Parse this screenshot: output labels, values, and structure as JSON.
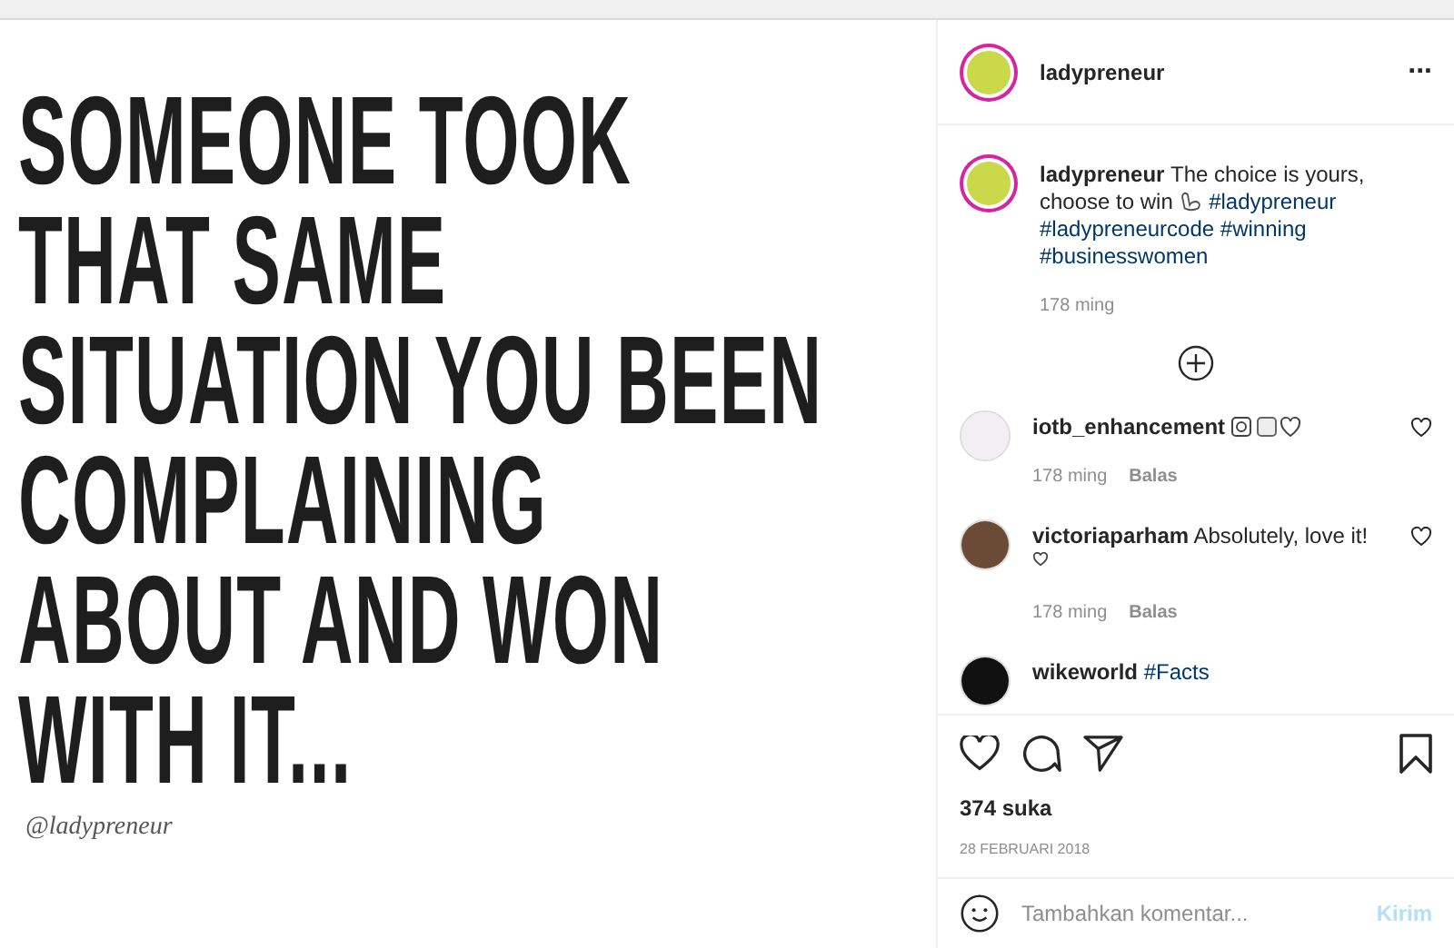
{
  "post_image": {
    "quote_lines": [
      "SOMEONE TOOK",
      "THAT SAME",
      "SITUATION YOU BEEN",
      "COMPLAINING",
      "ABOUT AND WON",
      "WITH IT..."
    ],
    "signature": "@ladypreneur"
  },
  "header": {
    "username": "ladypreneur",
    "more": "..."
  },
  "caption": {
    "username": "ladypreneur",
    "text": "The choice is yours, choose to win",
    "hashtags": [
      "#ladypreneur",
      "#ladypreneurcode",
      "#winning",
      "#businesswomen"
    ],
    "time": "178 ming"
  },
  "comments": [
    {
      "username": "iotb_enhancement",
      "time": "178 ming",
      "reply": "Balas",
      "kind": "emoji"
    },
    {
      "username": "victoriaparham",
      "text": "Absolutely, love it!",
      "time": "178 ming",
      "reply": "Balas",
      "kind": "heart"
    },
    {
      "username": "wikeworld",
      "text": "#Facts",
      "kind": "plain"
    }
  ],
  "likes": "374 suka",
  "date": "28 FEBRUARI 2018",
  "comment_box": {
    "placeholder": "Tambahkan komentar...",
    "send": "Kirim"
  }
}
